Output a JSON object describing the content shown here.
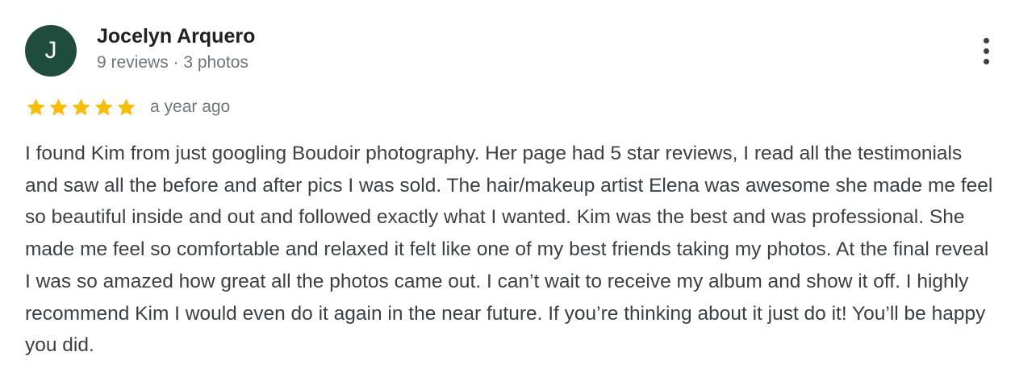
{
  "review": {
    "author": {
      "initial": "J",
      "name": "Jocelyn Arquero",
      "meta": "9 reviews · 3 photos",
      "avatar_color": "#1e4d3e"
    },
    "rating": 5,
    "rating_max": 5,
    "star_color": "#fbbc04",
    "timestamp": "a year ago",
    "text": "I found Kim from just googling Boudoir photography. Her page had 5 star reviews, I read all the testimonials and saw all the before and after pics I was sold. The hair/makeup artist Elena was awesome she made me feel so beautiful inside and out and followed exactly what I wanted. Kim was the best and was professional. She made me feel so comfortable and relaxed it felt like one of my best friends taking my photos. At the final reveal I was so amazed how great all the photos came out. I can’t wait to receive my album and show it off. I highly recommend Kim I would even do it again in the near future. If you’re thinking about it just do it! You’ll be happy you did.",
    "icons": {
      "more": "more-vert-icon",
      "star": "star-icon"
    }
  }
}
